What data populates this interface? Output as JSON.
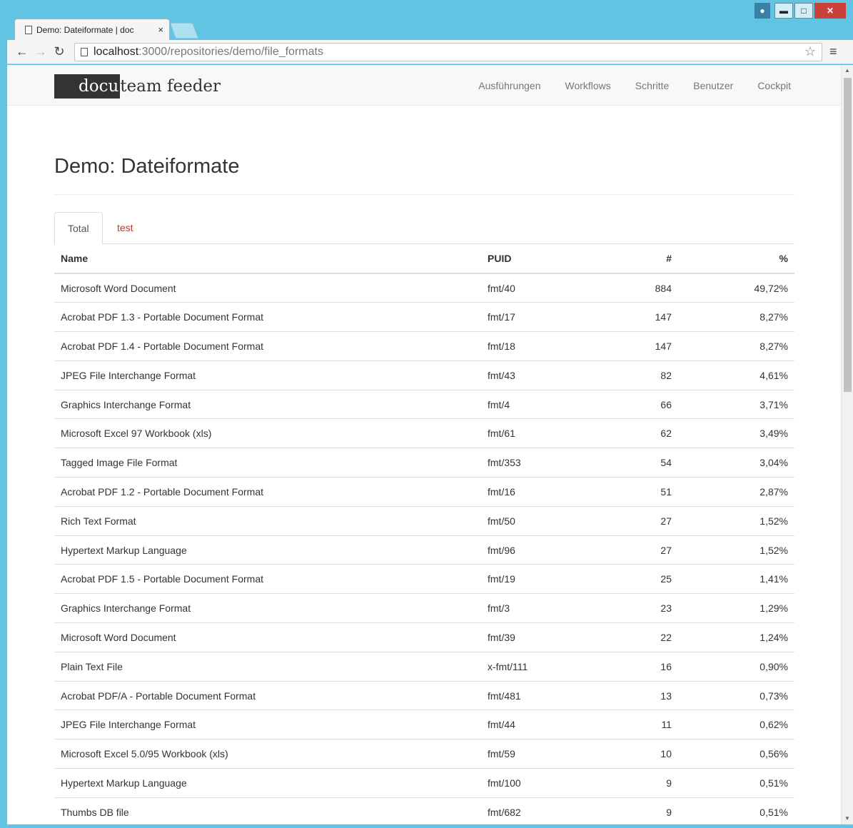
{
  "browser": {
    "tab_title": "Demo: Dateiformate | doc",
    "tab_close": "×",
    "url_host": "localhost",
    "url_path": ":3000/repositories/demo/file_formats"
  },
  "app": {
    "brand_box": "docu",
    "brand_rest": "team feeder",
    "nav": [
      "Ausführungen",
      "Workflows",
      "Schritte",
      "Benutzer",
      "Cockpit"
    ]
  },
  "page": {
    "title": "Demo: Dateiformate",
    "tabs": [
      "Total",
      "test"
    ]
  },
  "table": {
    "headers": [
      "Name",
      "PUID",
      "#",
      "%"
    ],
    "rows": [
      [
        "Microsoft Word Document",
        "fmt/40",
        "884",
        "49,72%"
      ],
      [
        "Acrobat PDF 1.3 - Portable Document Format",
        "fmt/17",
        "147",
        "8,27%"
      ],
      [
        "Acrobat PDF 1.4 - Portable Document Format",
        "fmt/18",
        "147",
        "8,27%"
      ],
      [
        "JPEG File Interchange Format",
        "fmt/43",
        "82",
        "4,61%"
      ],
      [
        "Graphics Interchange Format",
        "fmt/4",
        "66",
        "3,71%"
      ],
      [
        "Microsoft Excel 97 Workbook (xls)",
        "fmt/61",
        "62",
        "3,49%"
      ],
      [
        "Tagged Image File Format",
        "fmt/353",
        "54",
        "3,04%"
      ],
      [
        "Acrobat PDF 1.2 - Portable Document Format",
        "fmt/16",
        "51",
        "2,87%"
      ],
      [
        "Rich Text Format",
        "fmt/50",
        "27",
        "1,52%"
      ],
      [
        "Hypertext Markup Language",
        "fmt/96",
        "27",
        "1,52%"
      ],
      [
        "Acrobat PDF 1.5 - Portable Document Format",
        "fmt/19",
        "25",
        "1,41%"
      ],
      [
        "Graphics Interchange Format",
        "fmt/3",
        "23",
        "1,29%"
      ],
      [
        "Microsoft Word Document",
        "fmt/39",
        "22",
        "1,24%"
      ],
      [
        "Plain Text File",
        "x-fmt/111",
        "16",
        "0,90%"
      ],
      [
        "Acrobat PDF/A - Portable Document Format",
        "fmt/481",
        "13",
        "0,73%"
      ],
      [
        "JPEG File Interchange Format",
        "fmt/44",
        "11",
        "0,62%"
      ],
      [
        "Microsoft Excel 5.0/95 Workbook (xls)",
        "fmt/59",
        "10",
        "0,56%"
      ],
      [
        "Hypertext Markup Language",
        "fmt/100",
        "9",
        "0,51%"
      ],
      [
        "Thumbs DB file",
        "fmt/682",
        "9",
        "0,51%"
      ]
    ]
  },
  "colors": {
    "window_frame": "#62c4e3",
    "close_button": "#c9413a",
    "active_tab_link": "#c9302c"
  },
  "icons": {
    "back": "arrow-left-icon",
    "forward": "arrow-right-icon",
    "reload": "reload-icon",
    "page": "document-icon",
    "bookmark": "star-icon",
    "menu": "hamburger-menu-icon"
  }
}
